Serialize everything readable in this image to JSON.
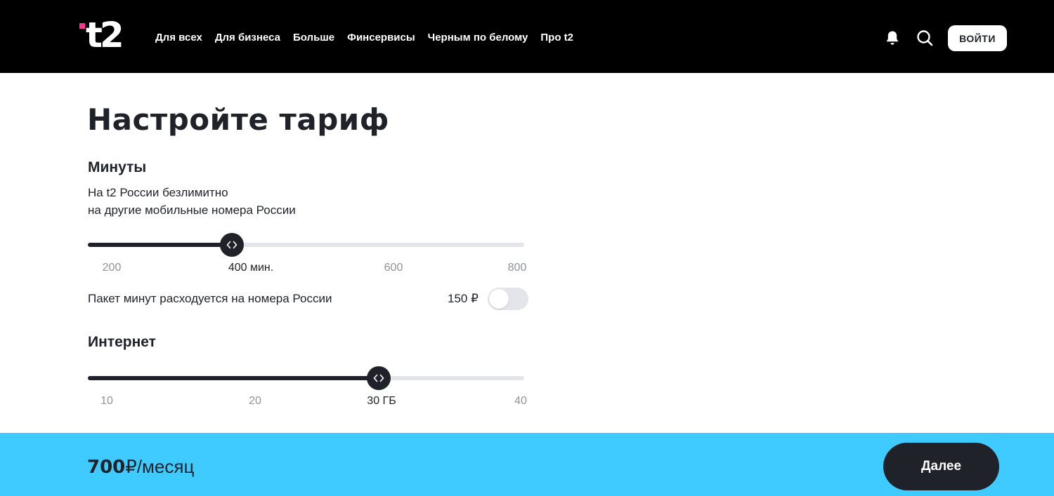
{
  "header": {
    "logo_text": "t2",
    "nav": [
      "Для всех",
      "Для бизнеса",
      "Больше",
      "Финсервисы",
      "Черным по белому",
      "Про t2"
    ],
    "icons": [
      "bell-icon",
      "search-icon"
    ],
    "login_label": "ВОЙТИ"
  },
  "page": {
    "title": "Настройте тариф"
  },
  "minutes": {
    "title": "Минуты",
    "desc_line1": "На t2 России безлимитно",
    "desc_line2": "на другие мобильные номера России",
    "slider": {
      "ticks": [
        "200",
        "400 мин.",
        "600",
        "800"
      ],
      "selected_index": 1,
      "value": 400,
      "fraction": 0.33
    },
    "package": {
      "label": "Пакет минут расходуется на номера России",
      "price": "150 ₽",
      "enabled": false
    }
  },
  "internet": {
    "title": "Интернет",
    "slider": {
      "ticks": [
        "10",
        "20",
        "30 ГБ",
        "40"
      ],
      "selected_index": 2,
      "value": 30,
      "fraction": 0.666
    }
  },
  "footer": {
    "price_amount": "700",
    "price_unit": "₽/месяц",
    "next_label": "Далее"
  },
  "colors": {
    "header_bg": "#000000",
    "brand_pink": "#ff3495",
    "text_dark": "#1f2229",
    "track_bg": "#e4e5ea",
    "tick_muted": "#8f9399",
    "pricebar_bg": "#3fcbff"
  }
}
